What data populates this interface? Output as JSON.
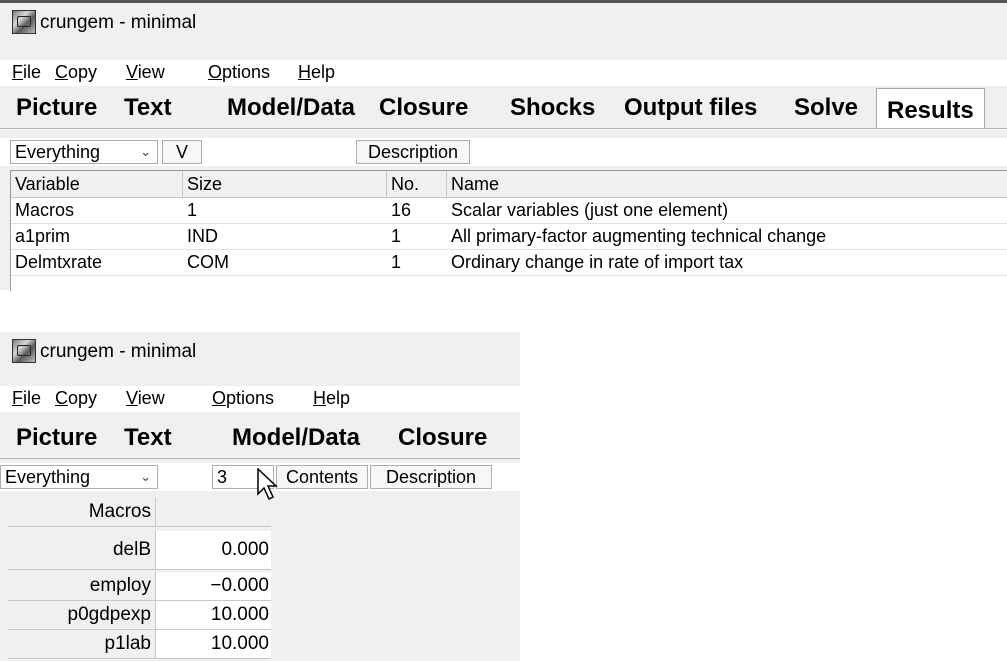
{
  "window1": {
    "title": "crungem - minimal",
    "menus": [
      "File",
      "Copy",
      "View",
      "Options",
      "Help"
    ],
    "tabs": [
      "Picture",
      "Text",
      "Model/Data",
      "Closure",
      "Shocks",
      "Output files",
      "Solve",
      "Results"
    ],
    "active_tab": "Results",
    "filter_select": "Everything",
    "v_button": "V",
    "description_button": "Description",
    "table": {
      "headers": [
        "Variable",
        "Size",
        "No.",
        "Name"
      ],
      "rows": [
        {
          "variable": "Macros",
          "size": "1",
          "no": "16",
          "name": "Scalar variables (just one element)"
        },
        {
          "variable": "a1prim",
          "size": "IND",
          "no": "1",
          "name": "All primary-factor augmenting technical change"
        },
        {
          "variable": "Delmtxrate",
          "size": "COM",
          "no": "1",
          "name": "Ordinary change in rate of import tax"
        }
      ]
    }
  },
  "window2": {
    "title": "crungem - minimal",
    "menus": [
      "File",
      "Copy",
      "View",
      "Options",
      "Help"
    ],
    "tabs": [
      "Picture",
      "Text",
      "Model/Data",
      "Closure"
    ],
    "filter_select": "Everything",
    "decimals_select": "3",
    "contents_button": "Contents",
    "description_button": "Description",
    "grid": {
      "header": "Macros",
      "rows": [
        {
          "label": "delB",
          "value": "0.000"
        },
        {
          "label": "employ",
          "value": "−0.000"
        },
        {
          "label": "p0gdpexp",
          "value": "10.000"
        },
        {
          "label": "p1lab",
          "value": "10.000"
        }
      ]
    }
  }
}
